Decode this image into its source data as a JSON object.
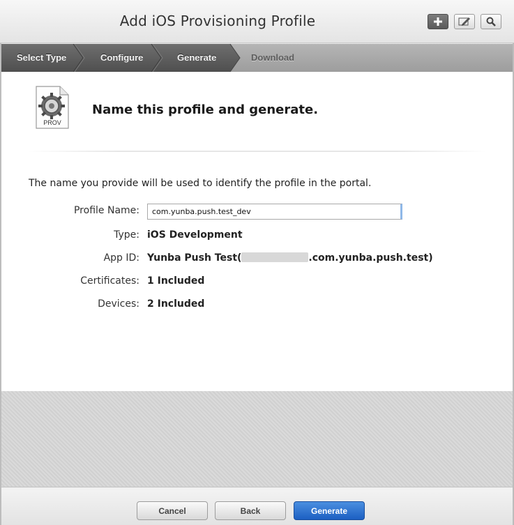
{
  "header": {
    "title": "Add iOS Provisioning Profile",
    "buttons": [
      {
        "name": "add",
        "icon": "plus-icon"
      },
      {
        "name": "edit",
        "icon": "pencil-icon"
      },
      {
        "name": "search",
        "icon": "search-icon"
      }
    ]
  },
  "steps": [
    {
      "label": "Select Type",
      "state": "done"
    },
    {
      "label": "Configure",
      "state": "done"
    },
    {
      "label": "Generate",
      "state": "current"
    },
    {
      "label": "Download",
      "state": "pending"
    }
  ],
  "main": {
    "icon_label": "PROV",
    "heading": "Name this profile and generate.",
    "description": "The name you provide will be used to identify the profile in the portal.",
    "fields": {
      "profile_name_label": "Profile Name:",
      "profile_name_value": "com.yunba.push.test_dev",
      "type_label": "Type:",
      "type_value": "iOS Development",
      "app_id_label": "App ID:",
      "app_id_prefix": "Yunba Push Test(",
      "app_id_suffix": ".com.yunba.push.test)",
      "certificates_label": "Certificates:",
      "certificates_value": "1 Included",
      "devices_label": "Devices:",
      "devices_value": "2 Included"
    }
  },
  "footer": {
    "cancel_label": "Cancel",
    "back_label": "Back",
    "generate_label": "Generate"
  },
  "colors": {
    "accent": "#1c5fc2",
    "steps_active_bg": "#5e5e5e",
    "steps_inactive_bg": "#a5a5a5"
  }
}
